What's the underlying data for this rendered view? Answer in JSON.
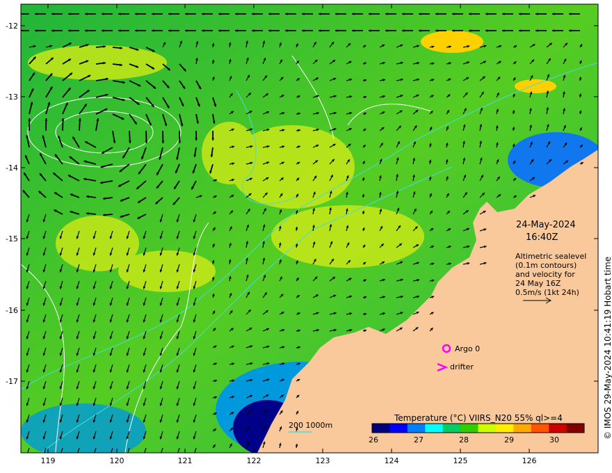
{
  "map": {
    "date": "24-May-2024",
    "time": "16:40Z",
    "note_lines": [
      "Altimetric sealevel",
      "(0.1m contours)",
      "and velocity for",
      "24 May 16Z",
      "0.5m/s (1kt 24h)"
    ],
    "copyright": "© IMOS 29-May-2024 10:41:19 Hobart time",
    "isobath_legend": "200  1000m",
    "legend_argo": "Argo 0",
    "legend_drifter": "drifter",
    "colorbar": {
      "title": "Temperature (°C) VIIRS_N20 55% ql>=4",
      "tick_labels": [
        "26",
        "27",
        "28",
        "29",
        "30"
      ],
      "colors": [
        "#00007f",
        "#0000ff",
        "#0080ff",
        "#00ffff",
        "#00cc66",
        "#33cc00",
        "#ccff00",
        "#ffee00",
        "#ffaa00",
        "#ff5500",
        "#cc0000",
        "#800000"
      ]
    },
    "x_ticks": [
      "119",
      "120",
      "121",
      "122",
      "123",
      "124",
      "125",
      "126"
    ],
    "y_ticks": [
      "-12",
      "-13",
      "-14",
      "-15",
      "-16",
      "-17"
    ],
    "colors": {
      "land": "#f9c99b",
      "argo": "#ff00ff",
      "isobath": "#44dddd",
      "contour": "#ffffff"
    }
  }
}
